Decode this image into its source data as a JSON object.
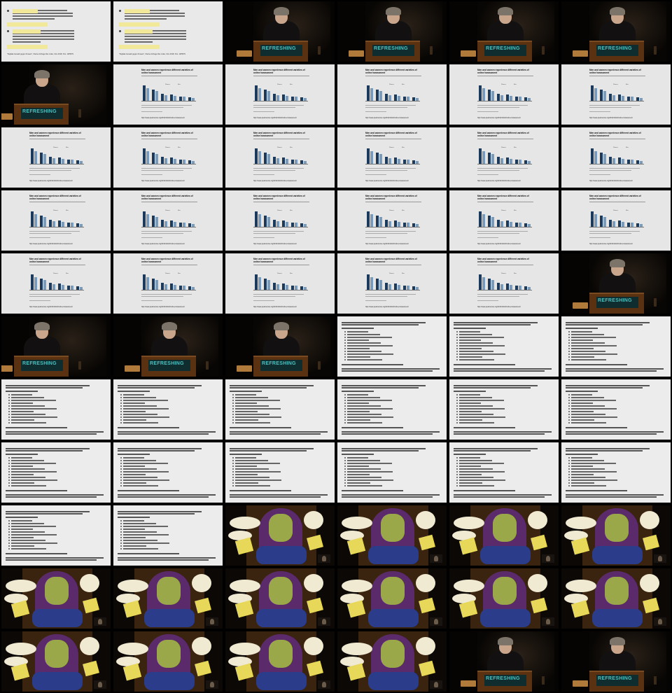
{
  "contact_sheet": {
    "columns": 6,
    "rows": 11,
    "frames": [
      "slide-german",
      "slide-german",
      "stage",
      "stage",
      "stage",
      "stage",
      "stage",
      "slide-chart",
      "slide-chart",
      "slide-chart",
      "slide-chart",
      "slide-chart",
      "slide-chart",
      "slide-chart",
      "slide-chart",
      "slide-chart",
      "slide-chart",
      "slide-chart",
      "slide-chart",
      "slide-chart",
      "slide-chart",
      "slide-chart",
      "slide-chart",
      "slide-chart",
      "slide-chart",
      "slide-chart",
      "slide-chart",
      "slide-chart",
      "slide-chart",
      "stage",
      "stage",
      "stage",
      "stage",
      "slide-list",
      "slide-list",
      "slide-list",
      "slide-list",
      "slide-list",
      "slide-list",
      "slide-list",
      "slide-list",
      "slide-list",
      "slide-list",
      "slide-list",
      "slide-list",
      "slide-list",
      "slide-list",
      "slide-list",
      "slide-list",
      "slide-list",
      "cartoon",
      "cartoon",
      "cartoon",
      "cartoon",
      "cartoon",
      "cartoon",
      "cartoon",
      "cartoon",
      "cartoon",
      "cartoon",
      "cartoon",
      "cartoon",
      "cartoon",
      "cartoon",
      "stage",
      "stage"
    ]
  },
  "slide_german": {
    "source": "\"Digitale Gewalt gegen Frauen\", Kleine Anfrage Die Linke, Nov 2018, Drs. 19/5579"
  },
  "stage": {
    "banner": "REFRESHING"
  },
  "slide_chart": {
    "title": "Men and women experience different varieties of online harassment",
    "legend_a": "Women",
    "legend_b": "Men",
    "url": "http://www.pewinternet.org/2014/10/22/online-harassment/"
  },
  "cartoon": {
    "caption": "Illustration: ..."
  },
  "colors": {
    "page_bg": "#000000",
    "slide_bg": "#e6e6e6",
    "bar_women": "#1b3a5c",
    "bar_men": "#7b9bb8",
    "podium": "#5a3212",
    "banner_text": "#4cc0c0"
  }
}
